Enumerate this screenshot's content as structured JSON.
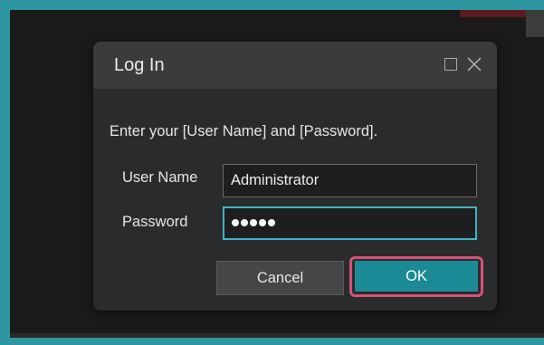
{
  "dialog": {
    "title": "Log In",
    "instruction": "Enter your [User Name] and [Password].",
    "fields": {
      "user_name_label": "User Name",
      "user_name_value": "Administrator",
      "password_label": "Password",
      "password_value": "•••••"
    },
    "buttons": {
      "cancel_label": "Cancel",
      "ok_label": "OK"
    },
    "window_controls": [
      "maximize-icon",
      "close-icon"
    ]
  },
  "colors": {
    "frame": "#2e96a0",
    "background": "#1a1a1a",
    "dialog_body": "#2a2b2c",
    "dialog_titlebar": "#3a3b3d",
    "password_focus_border": "#3fb5c6",
    "ok_button": "#1b8a94",
    "ok_highlight": "#d6517a"
  }
}
